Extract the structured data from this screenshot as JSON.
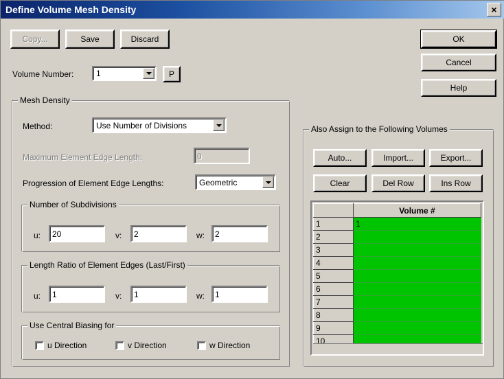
{
  "window": {
    "title": "Define Volume Mesh Density",
    "close_label": "×"
  },
  "toolbar": {
    "copy_label": "Copy...",
    "save_label": "Save",
    "discard_label": "Discard"
  },
  "action_buttons": {
    "ok_label": "OK",
    "cancel_label": "Cancel",
    "help_label": "Help"
  },
  "volume_number": {
    "label": "Volume Number:",
    "value": "1",
    "pick_label": "P"
  },
  "mesh_density": {
    "legend": "Mesh Density",
    "method_label": "Method:",
    "method_value": "Use Number of Divisions",
    "max_edge_label": "Maximum Element Edge Length:",
    "max_edge_value": "0",
    "progression_label": "Progression of Element Edge Lengths:",
    "progression_value": "Geometric",
    "subdivisions": {
      "legend": "Number of Subdivisions",
      "u_label": "u:",
      "u_value": "20",
      "v_label": "v:",
      "v_value": "2",
      "w_label": "w:",
      "w_value": "2"
    },
    "length_ratio": {
      "legend": "Length Ratio of Element Edges (Last/First)",
      "u_label": "u:",
      "u_value": "1",
      "v_label": "v:",
      "v_value": "1",
      "w_label": "w:",
      "w_value": "1"
    },
    "central_biasing": {
      "legend": "Use Central Biasing for",
      "u_label": "u Direction",
      "u_checked": false,
      "v_label": "v Direction",
      "v_checked": false,
      "w_label": "w Direction",
      "w_checked": false
    }
  },
  "also_assign": {
    "legend": "Also Assign to the Following Volumes",
    "auto_label": "Auto...",
    "import_label": "Import...",
    "export_label": "Export...",
    "clear_label": "Clear",
    "del_row_label": "Del Row",
    "ins_row_label": "Ins Row",
    "table": {
      "corner_header": "",
      "column_header": "Volume #",
      "rows": [
        {
          "index": "1",
          "value": "1"
        },
        {
          "index": "2",
          "value": ""
        },
        {
          "index": "3",
          "value": ""
        },
        {
          "index": "4",
          "value": ""
        },
        {
          "index": "5",
          "value": ""
        },
        {
          "index": "6",
          "value": ""
        },
        {
          "index": "7",
          "value": ""
        },
        {
          "index": "8",
          "value": ""
        },
        {
          "index": "9",
          "value": ""
        },
        {
          "index": "10",
          "value": ""
        }
      ]
    }
  },
  "colors": {
    "titlebar_start": "#0a246a",
    "titlebar_end": "#a6c8ec",
    "dialog_face": "#d4d0c8",
    "cell_green": "#00c400",
    "disabled_text": "#808080"
  }
}
